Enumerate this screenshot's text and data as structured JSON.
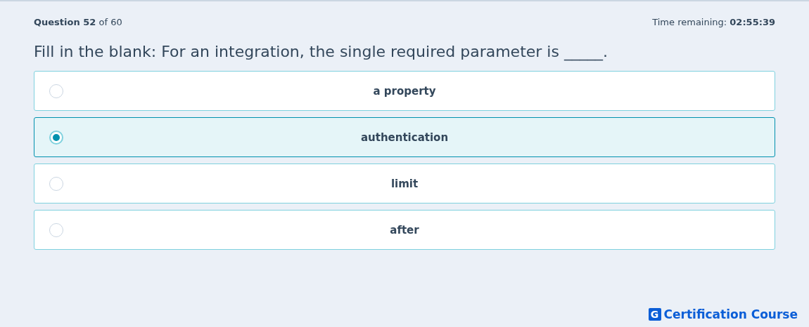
{
  "header": {
    "progress": "**Question 52** of 60",
    "timer": "Time remaining: **02:55:39**"
  },
  "question": "Fill in the blank: For an integration, the single required parameter is _____.",
  "options": [
    {
      "label": "a property",
      "selected": false
    },
    {
      "label": "authentication",
      "selected": true
    },
    {
      "label": "limit",
      "selected": false
    },
    {
      "label": "after",
      "selected": false
    }
  ],
  "brand": {
    "mark": "G",
    "name": "Certification Course"
  }
}
